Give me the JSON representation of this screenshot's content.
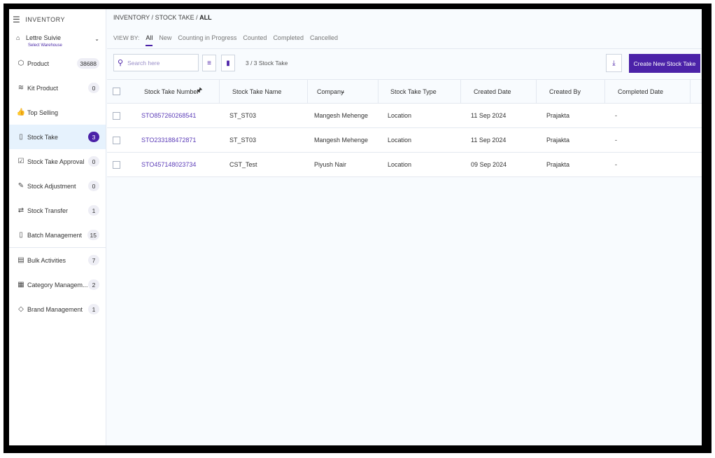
{
  "sidebar": {
    "title": "INVENTORY",
    "warehouse": {
      "name": "Lettre Suivie",
      "sub": "Select Warehouse"
    },
    "items": [
      {
        "label": "Product",
        "count": "38688",
        "icon": "box-icon"
      },
      {
        "label": "Kit Product",
        "count": "0",
        "icon": "layers-icon"
      },
      {
        "label": "Top Selling",
        "count": "",
        "icon": "thumbs-up-icon"
      },
      {
        "label": "Stock Take",
        "count": "3",
        "icon": "clipboard-icon",
        "active": true
      },
      {
        "label": "Stock Take Approval",
        "count": "0",
        "icon": "check-square-icon"
      },
      {
        "label": "Stock Adjustment",
        "count": "0",
        "icon": "edit-icon"
      },
      {
        "label": "Stock Transfer",
        "count": "1",
        "icon": "transfer-icon"
      },
      {
        "label": "Batch Management",
        "count": "15",
        "icon": "clipboard-icon"
      },
      {
        "label": "Bulk Activities",
        "count": "7",
        "icon": "list-icon"
      },
      {
        "label": "Category Managem...",
        "count": "2",
        "icon": "grid-icon"
      },
      {
        "label": "Brand Management",
        "count": "1",
        "icon": "tag-icon"
      }
    ]
  },
  "breadcrumb": {
    "p1": "INVENTORY",
    "sep": "/",
    "p2": "STOCK TAKE",
    "p3": "ALL"
  },
  "tabs": {
    "label": "VIEW BY:",
    "items": [
      "All",
      "New",
      "Counting in Progress",
      "Counted",
      "Completed",
      "Cancelled"
    ],
    "active": "All"
  },
  "toolbar": {
    "search_placeholder": "Search here",
    "count": "3 / 3 Stock Take",
    "create_label": "Create New Stock Take"
  },
  "accent": "#4b22a8",
  "table": {
    "headers": [
      "Stock Take Number",
      "Stock Take Name",
      "Company",
      "Stock Take Type",
      "Created Date",
      "Created By",
      "Completed Date"
    ],
    "rows": [
      [
        "STO857260268541",
        "ST_ST03",
        "Mangesh Mehenge",
        "Location",
        "11 Sep 2024",
        "Prajakta",
        "-"
      ],
      [
        "STO233188472871",
        "ST_ST03",
        "Mangesh Mehenge",
        "Location",
        "11 Sep 2024",
        "Prajakta",
        "-"
      ],
      [
        "STO457148023734",
        "CST_Test",
        "Piyush Nair",
        "Location",
        "09 Sep 2024",
        "Prajakta",
        "-"
      ]
    ]
  }
}
